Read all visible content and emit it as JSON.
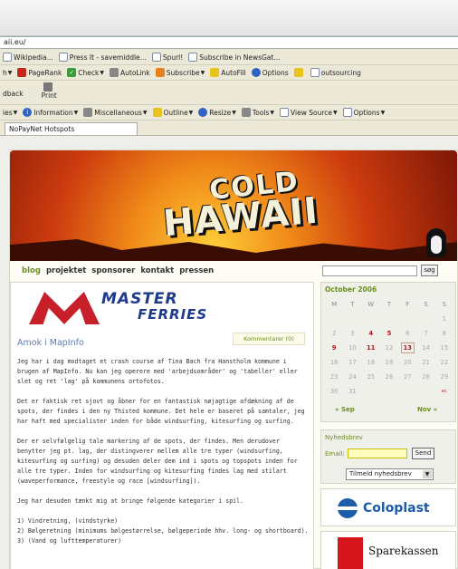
{
  "browser": {
    "address": "aii.eu/",
    "links_toolbar": [
      "Wikipedia...",
      "Press It - savemiddle...",
      "Spurl!",
      "Subscribe in NewsGat..."
    ],
    "toolbar2": [
      "h",
      "PageRank",
      "Check",
      "AutoLink",
      "Subscribe",
      "AutoFill",
      "Options",
      "outsourcing"
    ],
    "feedback_label": "dback",
    "print_label": "Print",
    "toolbar3": [
      "ies",
      "Information",
      "Miscellaneous",
      "Outline",
      "Resize",
      "Tools",
      "View Source",
      "Options"
    ],
    "tab_title": "NoPayNet Hotspots"
  },
  "site": {
    "logo_line1": "COLD",
    "logo_line2": "HAWAII",
    "nav": [
      "blog",
      "projektet",
      "sponsorer",
      "kontakt",
      "pressen"
    ],
    "search_button": "søg",
    "ad_line1": "MASTER",
    "ad_line2": "FERRIES",
    "post": {
      "title": "Amok i MapInfo",
      "comments": "Kommentarer (0)",
      "paragraphs": [
        "Jeg har i dag modtaget et crash course af Tina Bach fra Hanstholm kommune i brugen af MapInfo. Nu kan jeg operere med 'arbejdsområder' og 'tabeller' eller slet og ret 'lag' på kommunens ortofotos.",
        "Det er faktisk ret sjovt og åbner for en fantastisk nøjagtige afdækning af de spots, der findes i den ny Thisted kommune. Det hele er baseret på samtaler, jeg har haft med specialister inden for både windsurfing, kitesurfing og surfing.",
        "Der er selvfølgelig tale markering af de spots, der findes. Men derudover benytter jeg pt. lag, der distingverer mellem alle tre typer (windsurfing, kitesurfing og surfing) og desuden deler dem ind i spots og topspots inden for alle tre typer. Inden for windsurfing og kitesurfing findes lag med stilart (waveperformance, freestyle og race [windsurfing]).",
        "Jeg har desuden tænkt mig at bringe følgende kategorier i spil."
      ],
      "list": [
        "1) Vindretning, (vindstyrke)",
        "2) Bølgeretning (minimums bølgestørrelse, bølgeperiode hhv. long- og shortboard).",
        "3) (Vand og lufttemperaturer)"
      ]
    },
    "calendar": {
      "month": "October 2006",
      "weekdays": [
        "M",
        "T",
        "W",
        "T",
        "F",
        "S",
        "S"
      ],
      "weeks": [
        [
          "",
          "",
          "",
          "",
          "",
          "",
          "1"
        ],
        [
          "2",
          "3",
          "4",
          "5",
          "6",
          "7",
          "8"
        ],
        [
          "9",
          "10",
          "11",
          "12",
          "13",
          "14",
          "15"
        ],
        [
          "16",
          "17",
          "18",
          "19",
          "20",
          "21",
          "22"
        ],
        [
          "23",
          "24",
          "25",
          "26",
          "27",
          "28",
          "29"
        ],
        [
          "30",
          "31",
          "",
          "",
          "",
          "",
          "ec"
        ]
      ],
      "prev": "« Sep",
      "next": "Nov »"
    },
    "newsletter": {
      "title": "Nyhedsbrev",
      "email_label": "Email:",
      "send_button": "Send",
      "select_value": "Tilmeld nyhedsbrev"
    },
    "sponsor1": "Coloplast",
    "sponsor2": "Sparekassen"
  },
  "colors": {
    "accent": "#6b8e1f",
    "link": "#5a7ab0",
    "post_red": "#b01818",
    "ad_blue": "#1e3a8c"
  }
}
